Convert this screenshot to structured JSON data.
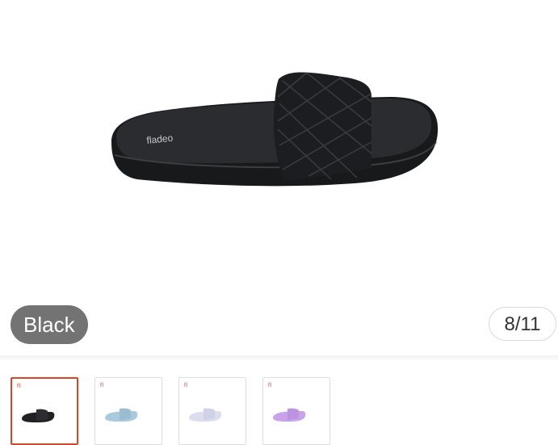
{
  "gallery": {
    "selected_color": "Black",
    "counter": "8/11",
    "product_brand": "fladeo"
  },
  "thumbnails": [
    {
      "color": "#1f2124",
      "selected": true
    },
    {
      "color": "#a9c9dc",
      "selected": false
    },
    {
      "color": "#dcdef0",
      "selected": false
    },
    {
      "color": "#c9a3ea",
      "selected": false
    }
  ],
  "colors": {
    "chip_bg": "#737373",
    "selected_border": "#d9462a",
    "sandal": "#1f2124"
  }
}
